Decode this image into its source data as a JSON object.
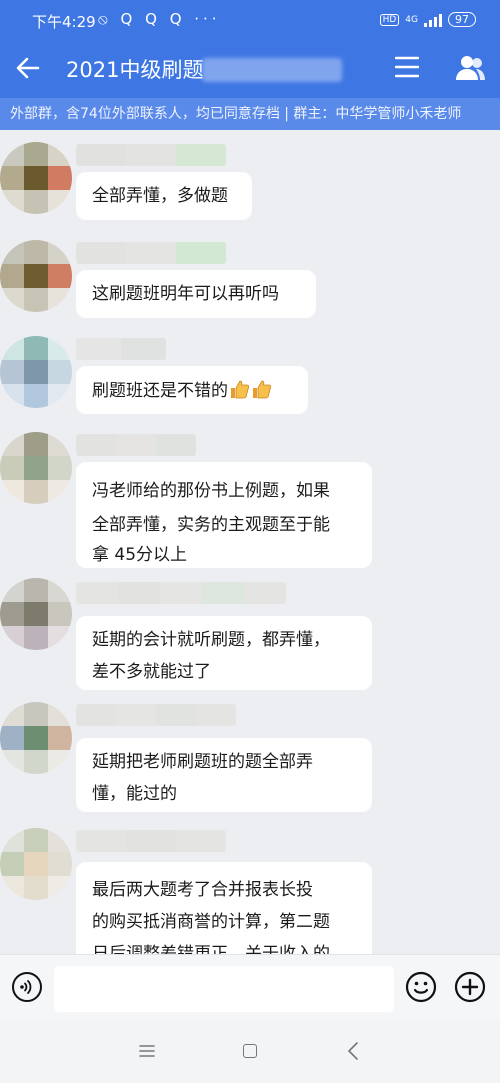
{
  "status_bar": {
    "time": "下午4:29",
    "icons": "⦸ Q Q Q ···",
    "hd": "HD",
    "network": "4G",
    "battery": "97"
  },
  "header": {
    "back_icon": "arrow-left-icon",
    "title": "2021中级刷题",
    "menu_icon": "hamburger-icon",
    "members_icon": "people-icon"
  },
  "notice": {
    "text": "外部群，含74位外部联系人，均已同意存档 | 群主：中华学管师小禾老师"
  },
  "colors": {
    "header_bg": "#3e76e4",
    "notice_bg": "#5a8ae9",
    "chat_bg": "#edeef1",
    "bubble_bg": "#ffffff"
  },
  "messages": [
    {
      "text": "全部弄懂，多做题"
    },
    {
      "text": "这刷题班明年可以再听吗"
    },
    {
      "text": "刷题班还是不错的",
      "emoji": [
        "thumbs-up-icon",
        "thumbs-up-icon"
      ]
    },
    {
      "lines": [
        "冯老师给的那份书上例题，如果",
        "全部弄懂，实务的主观题至于能",
        "拿 45分以上"
      ]
    },
    {
      "lines": [
        "延期的会计就听刷题，都弄懂，",
        "差不多就能过了"
      ]
    },
    {
      "lines": [
        "延期把老师刷题班的题全部弄",
        "懂，能过的"
      ]
    },
    {
      "lines": [
        "最后两大题考了合并报表长投",
        "的购买抵消商誉的计算，第二题",
        "日后调整差错更正，关于收入的"
      ]
    }
  ],
  "input_bar": {
    "voice_icon": "voice-icon",
    "emoji_icon": "smiley-icon",
    "plus_icon": "plus-circle-icon"
  },
  "system_nav": {
    "menu_icon": "menu-icon",
    "home_icon": "square-icon",
    "back_icon": "chevron-left-icon"
  }
}
